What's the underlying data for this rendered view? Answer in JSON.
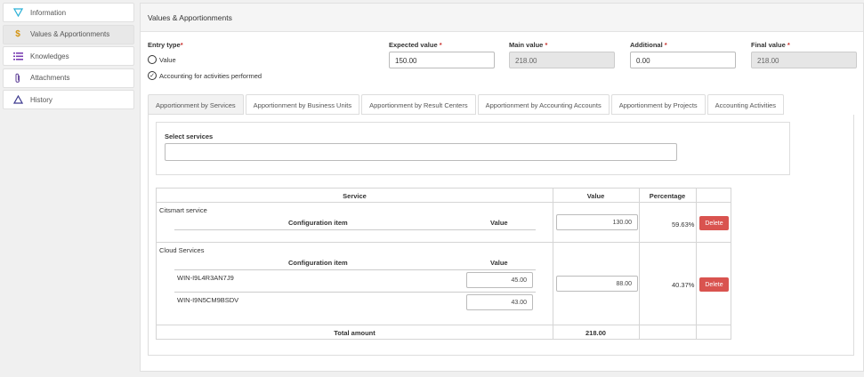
{
  "sidebar": {
    "items": [
      {
        "label": "Information",
        "icon": "filter-icon",
        "color": "#2ab0d6"
      },
      {
        "label": "Values & Apportionments",
        "icon": "dollar-icon",
        "color": "#d4930f"
      },
      {
        "label": "Knowledges",
        "icon": "list-icon",
        "color": "#7b3fb3"
      },
      {
        "label": "Attachments",
        "icon": "paperclip-icon",
        "color": "#6b4fa0"
      },
      {
        "label": "History",
        "icon": "triangle-icon",
        "color": "#3d3a8f"
      }
    ]
  },
  "header": {
    "title": "Values & Apportionments"
  },
  "form": {
    "entry_type_label": "Entry type",
    "option_value": "Value",
    "option_accounting": "Accounting for activities performed",
    "expected_label": "Expected value ",
    "expected_value": "150.00",
    "main_label": "Main value ",
    "main_value": "218.00",
    "additional_label": "Additional ",
    "additional_value": "0.00",
    "final_label": "Final value ",
    "final_value": "218.00",
    "required_mark": "*"
  },
  "tabs": [
    "Apportionment by Services",
    "Apportionment by Business Units",
    "Apportionment by Result Centers",
    "Apportionment by Accounting Accounts",
    "Apportionment by Projects",
    "Accounting Activities"
  ],
  "select_services": {
    "label": "Select services"
  },
  "table": {
    "headers": {
      "service": "Service",
      "value": "Value",
      "percentage": "Percentage"
    },
    "sub_headers": {
      "config_item": "Configuration item",
      "value": "Value"
    },
    "rows": [
      {
        "service": "Citsmart service",
        "value": "130.00",
        "percentage": "59.63%",
        "delete": "Delete",
        "items": []
      },
      {
        "service": "Cloud Services",
        "value": "88.00",
        "percentage": "40.37%",
        "delete": "Delete",
        "items": [
          {
            "name": "WIN-I9L4R3AN7J9",
            "value": "45.00"
          },
          {
            "name": "WIN-I9N5CM9BSDV",
            "value": "43.00"
          }
        ]
      }
    ],
    "total_label": "Total amount",
    "total_value": "218.00"
  }
}
